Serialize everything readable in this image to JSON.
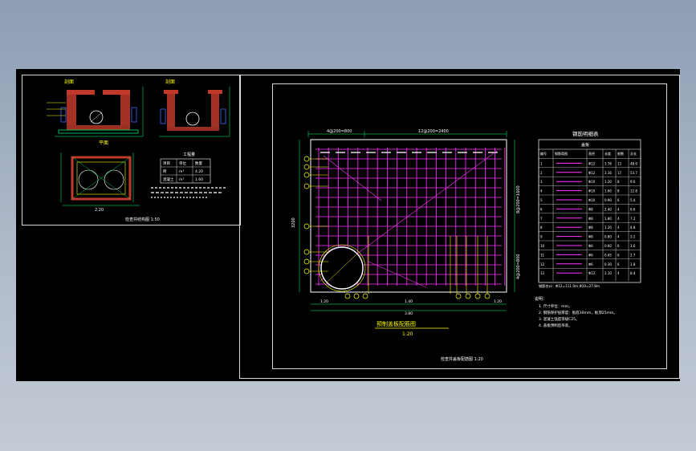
{
  "viewport": {
    "background": "#000000"
  },
  "colors": {
    "wall_hatch": "#c0392b",
    "dimension": "#00ff66",
    "text": "#ffffff",
    "annotation": "#ffff00",
    "rebar": "#ff33ff",
    "pipe": "#ffffff"
  },
  "left_sheet": {
    "section_a_label": "剖面",
    "section_b_label": "剖面",
    "plan_label": "平面",
    "bottom_dim": "2.20",
    "table_title": "工程量",
    "table_rows": [
      [
        "项目",
        "单位",
        "数量"
      ],
      [
        "砖",
        "m³",
        "4.20"
      ],
      [
        "混凝土",
        "m³",
        "1.60"
      ]
    ],
    "title": "检查井结构图 1:50"
  },
  "right_sheet": {
    "top_dims": [
      "4@200=800",
      "12@200=2400"
    ],
    "side_dims": [
      "4@200=800",
      "8@200=1600"
    ],
    "left_dim": "3200",
    "bottom_dims": [
      "1.20",
      "1.40",
      "1.20"
    ],
    "bottom_total": "3.80",
    "drawing_title": "预制盖板配筋图",
    "drawing_scale": "1:20",
    "sheet_title": "检查井盖板配筋图 1:20",
    "schedule_title": "钢筋明细表",
    "schedule_subtitle": "盖板",
    "schedule_headers": [
      "编号",
      "钢筋简图",
      "直径",
      "长度",
      "根数",
      "总长"
    ],
    "schedule_rows": [
      [
        "1",
        "Φ12",
        "3.76",
        "13",
        "48.9"
      ],
      [
        "2",
        "Φ12",
        "3.16",
        "17",
        "53.7"
      ],
      [
        "3",
        "Φ10",
        "1.20",
        "8",
        "9.6"
      ],
      [
        "4",
        "Φ10",
        "1.60",
        "8",
        "12.8"
      ],
      [
        "5",
        "Φ10",
        "0.90",
        "6",
        "5.4"
      ],
      [
        "6",
        "Φ8",
        "2.40",
        "4",
        "9.6"
      ],
      [
        "7",
        "Φ8",
        "1.80",
        "4",
        "7.2"
      ],
      [
        "8",
        "Φ8",
        "1.20",
        "4",
        "4.8"
      ],
      [
        "9",
        "Φ8",
        "0.80",
        "4",
        "3.2"
      ],
      [
        "10",
        "Φ6",
        "0.60",
        "6",
        "3.6"
      ],
      [
        "11",
        "Φ6",
        "0.45",
        "6",
        "2.7"
      ],
      [
        "12",
        "Φ6",
        "0.30",
        "6",
        "1.8"
      ],
      [
        "13",
        "Φ12",
        "2.10",
        "4",
        "8.4"
      ]
    ],
    "schedule_total": "钢筋合计：Φ12=111.0m Φ10=27.8m",
    "notes_title": "说明：",
    "notes": [
      "1. 尺寸单位：mm。",
      "2. 钢筋保护层厚度：板底30mm，板顶25mm。",
      "3. 混凝土强度等级C25。",
      "4. 盖板预制后吊装。"
    ]
  }
}
